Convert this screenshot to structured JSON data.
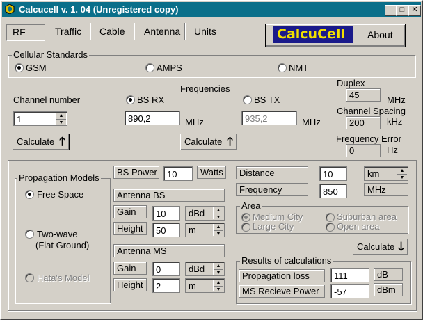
{
  "window": {
    "title": "Calcucell v. 1. 04 (Unregistered copy)",
    "min": "_",
    "max": "□",
    "close": "✕"
  },
  "tabs": [
    "RF",
    "Traffic",
    "Cable",
    "Antenna",
    "Units"
  ],
  "logo": {
    "text": "CalcuCell",
    "about": "About"
  },
  "standards": {
    "label": "Cellular Standards",
    "options": [
      "GSM",
      "AMPS",
      "NMT"
    ],
    "selected": "GSM"
  },
  "channel": {
    "label": "Channel number",
    "value": "1",
    "calc": "Calculate"
  },
  "frequencies": {
    "label": "Frequencies",
    "bs_rx": {
      "label": "BS RX",
      "value": "890,2",
      "unit": "MHz"
    },
    "bs_tx": {
      "label": "BS TX",
      "value": "935,2",
      "unit": "MHz"
    },
    "calc": "Calculate"
  },
  "duplex": {
    "label": "Duplex",
    "value": "45",
    "unit": "MHz"
  },
  "spacing": {
    "label": "Channel Spacing",
    "value": "200",
    "unit": "kHz"
  },
  "freq_error": {
    "label": "Frequency Error",
    "value": "0",
    "unit": "Hz"
  },
  "propagation": {
    "label": "Propagation Models",
    "free_space": "Free Space",
    "two_wave": "Two-wave",
    "two_wave_sub": "(Flat Ground)",
    "hata": "Hata's Model"
  },
  "bs_power": {
    "label": "BS Power",
    "value": "10",
    "unit": "Watts"
  },
  "antenna_bs": {
    "label": "Antenna BS",
    "gain_label": "Gain",
    "gain": "10",
    "gain_unit": "dBd",
    "height_label": "Height",
    "height": "50",
    "height_unit": "m"
  },
  "antenna_ms": {
    "label": "Antenna MS",
    "gain_label": "Gain",
    "gain": "0",
    "gain_unit": "dBd",
    "height_label": "Height",
    "height": "2",
    "height_unit": "m"
  },
  "distance": {
    "label": "Distance",
    "value": "10",
    "unit": "km"
  },
  "frequency": {
    "label": "Frequency",
    "value": "850",
    "unit": "MHz"
  },
  "area": {
    "label": "Area",
    "medium": "Medium City",
    "suburban": "Suburban area",
    "large": "Large City",
    "open": "Open area"
  },
  "calc_down": "Calculate",
  "results": {
    "label": "Results of calculations",
    "loss_label": "Propagation loss",
    "loss": "111",
    "loss_unit": "dB",
    "power_label": "MS Recieve Power",
    "power": "-57",
    "power_unit": "dBm"
  }
}
